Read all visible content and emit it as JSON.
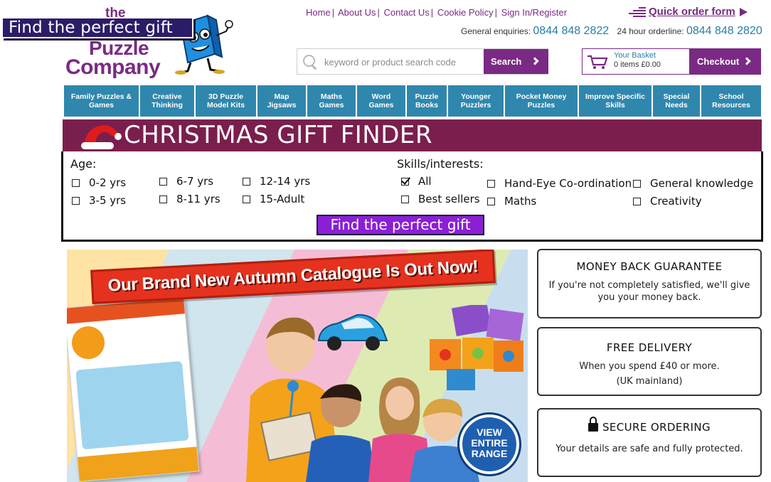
{
  "header": {
    "logo": {
      "line1": "the",
      "line2": "Puzzle",
      "line3": "Company",
      "mascot_icon": "puzzle-cube-mascot"
    },
    "gift_tab_label": "Find the perfect gift",
    "top_links": [
      "Home",
      "About Us",
      "Contact Us",
      "Cookie Policy",
      "Sign In/Register"
    ],
    "quick_order_label": "Quick order form",
    "phones": {
      "enquiries_label": "General enquiries:",
      "enquiries_number": "0844 848 2822",
      "orderline_label": "24 hour orderline:",
      "orderline_number": "0844 848 2820"
    },
    "search": {
      "placeholder": "keyword or product search code",
      "button_label": "Search"
    },
    "basket": {
      "title": "Your Basket",
      "items": "0 items £0.00",
      "checkout_label": "Checkout"
    }
  },
  "nav": {
    "items": [
      "Family Puzzles & Games",
      "Creative Thinking",
      "3D Puzzle Model Kits",
      "Map Jigsaws",
      "Maths Games",
      "Word Games",
      "Puzzle Books",
      "Younger Puzzlers",
      "Pocket Money Puzzles",
      "Improve Specific Skills",
      "Special Needs",
      "School Resources"
    ]
  },
  "gift_finder": {
    "title": "CHRISTMAS GIFT FINDER",
    "age_label": "Age:",
    "ages": [
      "0-2 yrs",
      "6-7 yrs",
      "12-14 yrs",
      "3-5 yrs",
      "8-11 yrs",
      "15-Adult"
    ],
    "skills_label": "Skills/interests:",
    "skills": [
      {
        "label": "All",
        "checked": true
      },
      {
        "label": "Hand-Eye Co-ordination",
        "checked": false
      },
      {
        "label": "General knowledge",
        "checked": false
      },
      {
        "label": "Best sellers",
        "checked": false
      },
      {
        "label": "Maths",
        "checked": false
      },
      {
        "label": "Creativity",
        "checked": false
      }
    ],
    "button_label": "Find the perfect gift"
  },
  "hero": {
    "headline": "Our Brand New Autumn Catalogue Is Out Now!",
    "view_range_label": "VIEW ENTIRE RANGE"
  },
  "info_boxes": [
    {
      "heading": "MONEY BACK GUARANTEE",
      "text": "If you're not completely satisfied, we'll give you your money back."
    },
    {
      "heading": "FREE DELIVERY",
      "text": "When you spend £40 or more.",
      "text2": "(UK mainland)"
    },
    {
      "heading": "SECURE ORDERING",
      "text": "Your details are safe and fully protected.",
      "icon": "lock-icon"
    }
  ],
  "colors": {
    "brand_purple": "#7a2a84",
    "nav_blue": "#2f87ad",
    "finder_banner": "#7a1f4d",
    "find_button": "#8b1fd6",
    "phone_blue": "#2a7ea8"
  }
}
